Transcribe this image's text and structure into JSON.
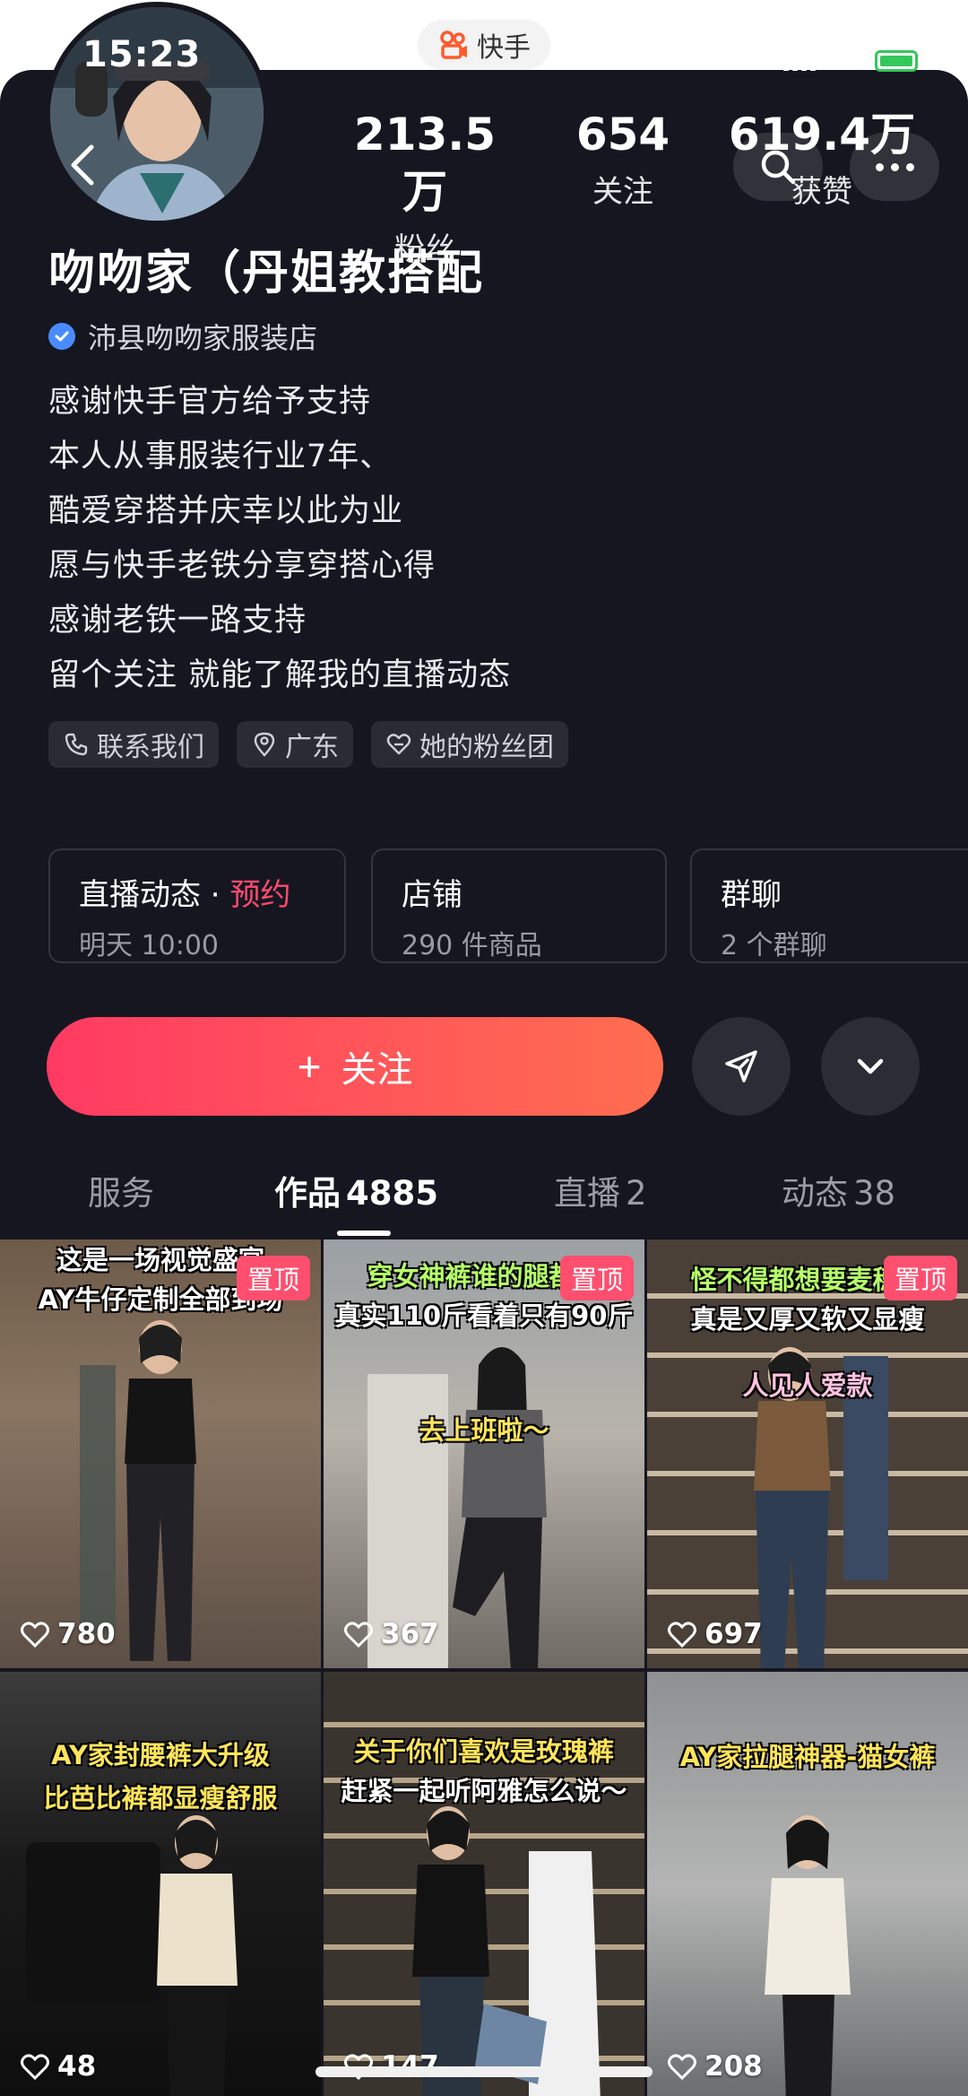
{
  "status_bar": {
    "time": "15:23",
    "app_name": "快手"
  },
  "stats": [
    {
      "value": "213.5万",
      "label": "粉丝"
    },
    {
      "value": "654",
      "label": "关注"
    },
    {
      "value": "619.4万",
      "label": "获赞"
    }
  ],
  "profile": {
    "name": "吻吻家（丹姐教搭配",
    "verified_label": "沛县吻吻家服装店",
    "bio": [
      "感谢快手官方给予支持",
      "本人从事服装行业7年、",
      "酷爱穿搭并庆幸以此为业",
      "愿与快手老铁分享穿搭心得",
      "感谢老铁一路支持",
      "留个关注 就能了解我的直播动态"
    ],
    "tags": [
      "联系我们",
      "广东",
      "她的粉丝团"
    ]
  },
  "cards": {
    "live": {
      "title": "直播动态",
      "sep": " · ",
      "accent": "预约",
      "sub": "明天 10:00"
    },
    "shop": {
      "title": "店铺",
      "sub": "290 件商品"
    },
    "group": {
      "title": "群聊",
      "sub": "2 个群聊"
    }
  },
  "actions": {
    "follow_label": "关注"
  },
  "tabs": [
    {
      "label": "服务",
      "count": ""
    },
    {
      "label": "作品",
      "count": "4885"
    },
    {
      "label": "直播",
      "count": "2"
    },
    {
      "label": "动态",
      "count": "38"
    }
  ],
  "pin_label": "置顶",
  "videos": [
    {
      "cap1": "这是一场视觉盛宴",
      "cap2": "AY牛仔定制全部到场",
      "likes": "780"
    },
    {
      "cap1": "穿女神裤谁的腿都不",
      "cap2": "真实110斤看着只有90斤",
      "cap3": "去上班啦～",
      "likes": "367"
    },
    {
      "cap1": "怪不得都想要麦穗裤",
      "cap2": "真是又厚又软又显瘦",
      "cap3": "人见人爱款",
      "likes": "697"
    },
    {
      "cap1": "AY家封腰裤大升级",
      "cap2": "比芭比裤都显瘦舒服",
      "likes": "48"
    },
    {
      "cap1": "关于你们喜欢是玫瑰裤",
      "cap2": "赶紧一起听阿雅怎么说～",
      "likes": "147"
    },
    {
      "cap1": "AY家拉腿神器-猫女裤",
      "likes": "208"
    }
  ],
  "colors": {
    "background": "#161620",
    "accent_pink": "#ff4b6e",
    "follow_gradient_start": "#ff3a63",
    "follow_gradient_end": "#ff6d4f"
  }
}
